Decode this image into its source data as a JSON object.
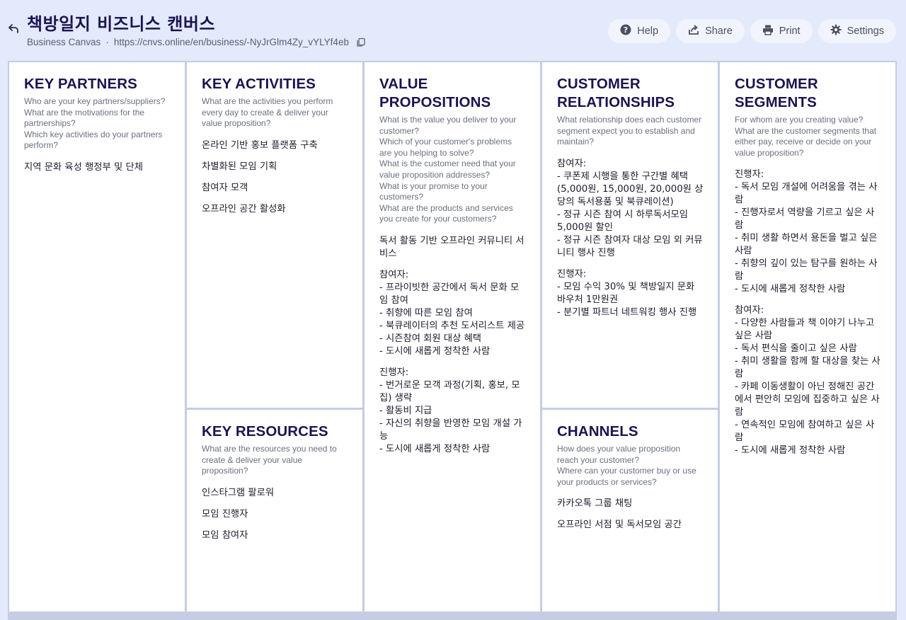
{
  "header": {
    "back_icon": "undo-arrow-icon",
    "title": "책방일지 비즈니스 캔버스",
    "canvas_type": "Business Canvas",
    "separator": "·",
    "url": "https://cnvs.online/en/business/-NyJrGlm4Zy_vYLYf4eb",
    "copy_icon": "copy-icon"
  },
  "actions": [
    {
      "label": "Help",
      "icon": "help-circle-icon"
    },
    {
      "label": "Share",
      "icon": "share-icon"
    },
    {
      "label": "Print",
      "icon": "printer-icon"
    },
    {
      "label": "Settings",
      "icon": "gear-icon"
    }
  ],
  "colors": {
    "background": "#e2eafb",
    "title": "#1b1450",
    "grid_line": "#c5cde3",
    "button_bg": "#f1f4fc"
  },
  "sections": {
    "key_partners": {
      "title": "KEY PARTNERS",
      "question": "Who are your key partners/suppliers?\nWhat are the motivations for the partnerships?\nWhich key activities do your partners perform?",
      "notes": [
        "지역 문화 육성 행정부 및 단체"
      ]
    },
    "key_activities": {
      "title": "KEY ACTIVITIES",
      "question": "What are the activities you perform every day to create & deliver your value proposition?",
      "notes": [
        "온라인 기반 홍보 플랫폼 구축",
        "차별화된 모임 기획",
        "참여자 모객",
        "오프라인 공간 활성화"
      ]
    },
    "key_resources": {
      "title": "KEY RESOURCES",
      "question": "What are the resources you need to create & deliver your value proposition?",
      "notes": [
        "인스타그램 팔로워",
        "모임 진행자",
        "모임 참여자"
      ]
    },
    "value_propositions": {
      "title": "VALUE PROPOSITIONS",
      "question": "What is the value you deliver to your customer?\nWhich of your customer's problems are you helping to solve?\nWhat is the customer need that your value proposition addresses?\nWhat is your promise to your customers?\nWhat are the products and services you create for your customers?",
      "notes": [
        "독서 활동 기반 오프라인 커뮤니티 서비스",
        "참여자:\n- 프라이빗한 공간에서 독서 문화 모임 참여\n- 취향에 따른 모임 참여\n- 북큐레이터의 추천 도서리스트 제공\n- 시즌참여 회원 대상 혜택\n- 도시에 새롭게 정착한 사람",
        "진행자:\n- 번거로운 모객 과정(기획, 홍보, 모집) 생략\n- 활동비 지급\n- 자신의 취향을 반영한 모임 개설 가능\n- 도시에 새롭게 정착한 사람"
      ]
    },
    "customer_relationships": {
      "title": "CUSTOMER RELATIONSHIPS",
      "question": "What relationship does each customer segment expect you to establish and maintain?",
      "notes": [
        "참여자:\n- 쿠폰제 시행을 통한 구간별 혜택 (5,000원, 15,000원, 20,000원 상당의 독서용품 및 북큐레이션)\n- 정규 시즌 참여 시 하루독서모임 5,000원 할인\n- 정규 시즌 참여자 대상 모임 외 커뮤니티 행사 진행",
        "진행자:\n- 모임 수익 30% 및 책방일지 문화 바우처 1만원권\n- 분기별 파트너 네트워킹 행사 진행"
      ]
    },
    "channels": {
      "title": "CHANNELS",
      "question": "How does your value proposition reach your customer?\nWhere can your customer buy or use your products or services?",
      "notes": [
        "카카오톡 그룹 채팅",
        "오프라인 서점 및 독서모임 공간"
      ]
    },
    "customer_segments": {
      "title": "CUSTOMER SEGMENTS",
      "question": "For whom are you creating value?\nWhat are the customer segments that either pay, receive or decide on your value proposition?",
      "notes": [
        "진행자:\n- 독서 모임 개설에 어려움을 겪는 사람\n- 진행자로서 역량을 기르고 싶은 사람\n- 취미 생활 하면서 용돈을 벌고 싶은 사람\n- 취향의 깊이 있는 탐구를 원하는 사람\n- 도시에 새롭게 정착한 사람",
        "참여자:\n- 다양한 사람들과 책 이야기 나누고 싶은 사람\n- 독서 편식을 줄이고 싶은 사람\n- 취미 생활을 함께 할 대상을 찾는 사람\n- 카페 이동생활이 아닌 정해진 공간에서 편안히 모임에 집중하고 싶은 사람\n- 연속적인 모임에 참여하고 싶은 사람\n- 도시에 새롭게 정착한 사람"
      ]
    }
  }
}
